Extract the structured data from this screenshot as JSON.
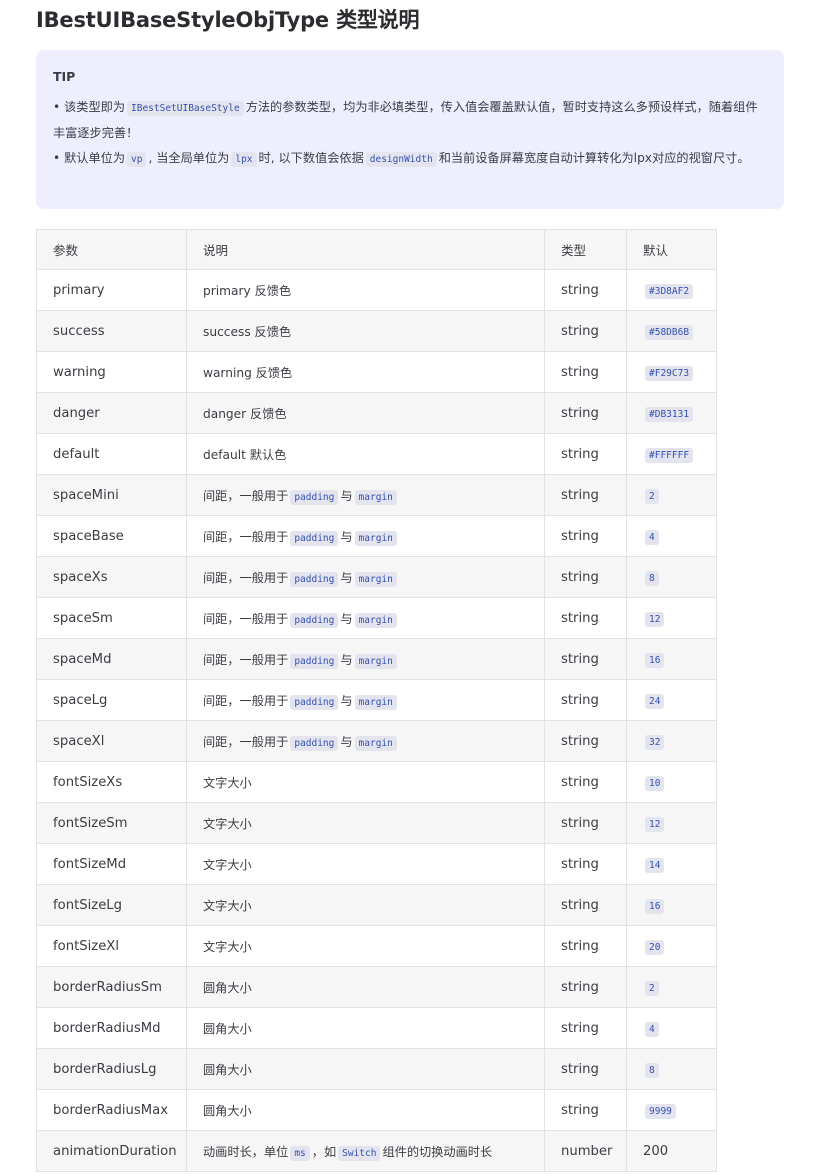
{
  "title": "IBestUIBaseStyleObjType 类型说明",
  "tip": {
    "heading": "TIP",
    "line1": {
      "prefix": "• 该类型即为",
      "code": "IBestSetUIBaseStyle",
      "suffix": "方法的参数类型，均为非必填类型，传入值会覆盖默认值，暂时支持这么多预设样式，随着组件丰富逐步完善！"
    },
    "line2": {
      "prefix": "• 默认单位为",
      "code1": "vp",
      "mid1": ", 当全局单位为",
      "code2": "lpx",
      "mid2": "时, 以下数值会依据",
      "code3": "designWidth",
      "suffix": "和当前设备屏幕宽度自动计算转化为lpx对应的视窗尺寸。"
    }
  },
  "table": {
    "headers": [
      "参数",
      "说明",
      "类型",
      "默认"
    ],
    "rows": [
      {
        "param": "primary",
        "desc": "primary 反馈色",
        "type": "string",
        "default": "#3D8AF2",
        "default_code": true
      },
      {
        "param": "success",
        "desc": "success 反馈色",
        "type": "string",
        "default": "#58DB6B",
        "default_code": true
      },
      {
        "param": "warning",
        "desc": "warning 反馈色",
        "type": "string",
        "default": "#F29C73",
        "default_code": true
      },
      {
        "param": "danger",
        "desc": "danger 反馈色",
        "type": "string",
        "default": "#DB3131",
        "default_code": true
      },
      {
        "param": "default",
        "desc": "default 默认色",
        "type": "string",
        "default": "#FFFFFF",
        "default_code": true
      },
      {
        "param": "spaceMini",
        "desc_parts": [
          "间距，一般用于",
          "padding",
          "与",
          "margin"
        ],
        "type": "string",
        "default": "2",
        "default_code": true
      },
      {
        "param": "spaceBase",
        "desc_parts": [
          "间距，一般用于",
          "padding",
          "与",
          "margin"
        ],
        "type": "string",
        "default": "4",
        "default_code": true
      },
      {
        "param": "spaceXs",
        "desc_parts": [
          "间距，一般用于",
          "padding",
          "与",
          "margin"
        ],
        "type": "string",
        "default": "8",
        "default_code": true
      },
      {
        "param": "spaceSm",
        "desc_parts": [
          "间距，一般用于",
          "padding",
          "与",
          "margin"
        ],
        "type": "string",
        "default": "12",
        "default_code": true
      },
      {
        "param": "spaceMd",
        "desc_parts": [
          "间距，一般用于",
          "padding",
          "与",
          "margin"
        ],
        "type": "string",
        "default": "16",
        "default_code": true
      },
      {
        "param": "spaceLg",
        "desc_parts": [
          "间距，一般用于",
          "padding",
          "与",
          "margin"
        ],
        "type": "string",
        "default": "24",
        "default_code": true
      },
      {
        "param": "spaceXl",
        "desc_parts": [
          "间距，一般用于",
          "padding",
          "与",
          "margin"
        ],
        "type": "string",
        "default": "32",
        "default_code": true
      },
      {
        "param": "fontSizeXs",
        "desc": "文字大小",
        "type": "string",
        "default": "10",
        "default_code": true
      },
      {
        "param": "fontSizeSm",
        "desc": "文字大小",
        "type": "string",
        "default": "12",
        "default_code": true
      },
      {
        "param": "fontSizeMd",
        "desc": "文字大小",
        "type": "string",
        "default": "14",
        "default_code": true
      },
      {
        "param": "fontSizeLg",
        "desc": "文字大小",
        "type": "string",
        "default": "16",
        "default_code": true
      },
      {
        "param": "fontSizeXl",
        "desc": "文字大小",
        "type": "string",
        "default": "20",
        "default_code": true
      },
      {
        "param": "borderRadiusSm",
        "desc": "圆角大小",
        "type": "string",
        "default": "2",
        "default_code": true
      },
      {
        "param": "borderRadiusMd",
        "desc": "圆角大小",
        "type": "string",
        "default": "4",
        "default_code": true
      },
      {
        "param": "borderRadiusLg",
        "desc": "圆角大小",
        "type": "string",
        "default": "8",
        "default_code": true
      },
      {
        "param": "borderRadiusMax",
        "desc": "圆角大小",
        "type": "string",
        "default": "9999",
        "default_code": true
      },
      {
        "param": "animationDuration",
        "desc_parts": [
          "动画时长，单位",
          "ms",
          "，如",
          "Switch",
          "组件的切换动画时长"
        ],
        "type": "number",
        "default": "200",
        "default_code": false
      }
    ]
  }
}
